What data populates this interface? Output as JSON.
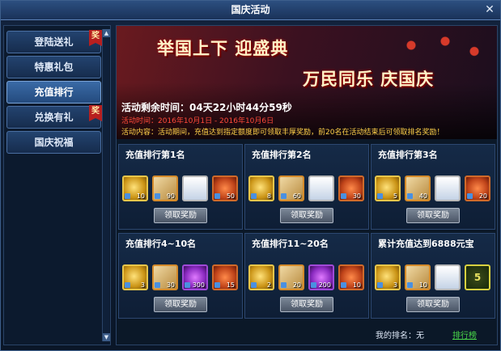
{
  "window": {
    "title": "国庆活动"
  },
  "sidebar": {
    "items": [
      {
        "label": "登陆送礼",
        "badge": "奖",
        "active": false
      },
      {
        "label": "特惠礼包",
        "badge": "",
        "active": false
      },
      {
        "label": "充值排行",
        "badge": "",
        "active": true
      },
      {
        "label": "兑换有礼",
        "badge": "奖",
        "active": false
      },
      {
        "label": "国庆祝福",
        "badge": "",
        "active": false
      }
    ]
  },
  "banner": {
    "line1": "举国上下 迎盛典",
    "line2": "万民同乐 庆国庆",
    "remaining": "活动剩余时间：04天22小时44分59秒",
    "time": "活动时间：2016年10月1日 - 2016年10月6日",
    "desc": "活动内容：活动期间，充值达到指定额度即可领取丰厚奖励，前20名在活动结束后可领取排名奖励！"
  },
  "rewards": [
    {
      "title": "充值排行第1名",
      "button": "领取奖励",
      "items": [
        {
          "kind": "gold",
          "icon": "gold-ingot-icon",
          "qty": "10"
        },
        {
          "kind": "scroll",
          "icon": "scroll-icon",
          "qty": "90"
        },
        {
          "kind": "char",
          "icon": "character-icon",
          "qty": ""
        },
        {
          "kind": "ore",
          "icon": "ore-icon",
          "qty": "50"
        }
      ]
    },
    {
      "title": "充值排行第2名",
      "button": "领取奖励",
      "items": [
        {
          "kind": "gold",
          "icon": "gold-ingot-icon",
          "qty": "8"
        },
        {
          "kind": "scroll",
          "icon": "scroll-icon",
          "qty": "60"
        },
        {
          "kind": "char",
          "icon": "character-icon",
          "qty": ""
        },
        {
          "kind": "ore",
          "icon": "ore-icon",
          "qty": "30"
        }
      ]
    },
    {
      "title": "充值排行第3名",
      "button": "领取奖励",
      "items": [
        {
          "kind": "gold",
          "icon": "gold-ingot-icon",
          "qty": "5"
        },
        {
          "kind": "scroll",
          "icon": "scroll-icon",
          "qty": "40"
        },
        {
          "kind": "char",
          "icon": "character-icon",
          "qty": ""
        },
        {
          "kind": "ore",
          "icon": "ore-icon",
          "qty": "20"
        }
      ]
    },
    {
      "title": "充值排行4~10名",
      "button": "领取奖励",
      "items": [
        {
          "kind": "gold",
          "icon": "gold-ingot-icon",
          "qty": "3"
        },
        {
          "kind": "scroll",
          "icon": "scroll-icon",
          "qty": "30"
        },
        {
          "kind": "gem",
          "icon": "gem-icon",
          "qty": "300"
        },
        {
          "kind": "ore",
          "icon": "ore-icon",
          "qty": "15"
        }
      ]
    },
    {
      "title": "充值排行11~20名",
      "button": "领取奖励",
      "items": [
        {
          "kind": "gold",
          "icon": "gold-ingot-icon",
          "qty": "2"
        },
        {
          "kind": "scroll",
          "icon": "scroll-icon",
          "qty": "20"
        },
        {
          "kind": "gem",
          "icon": "gem-icon",
          "qty": "200"
        },
        {
          "kind": "ore",
          "icon": "ore-icon",
          "qty": "10"
        }
      ]
    },
    {
      "title": "累计充值达到6888元宝",
      "button": "领取奖励",
      "items": [
        {
          "kind": "gold",
          "icon": "gold-ingot-icon",
          "qty": "3"
        },
        {
          "kind": "scroll",
          "icon": "scroll-icon",
          "qty": "10"
        },
        {
          "kind": "char",
          "icon": "character-icon",
          "qty": ""
        },
        {
          "kind": "coin",
          "icon": "coin-icon",
          "qty": "5"
        }
      ]
    }
  ],
  "footer": {
    "my_rank": "我的排名：无",
    "leaderboard": "排行榜"
  },
  "colors": {
    "accent": "#4ad84a",
    "warning": "#ff4a3a",
    "highlight": "#ffd24a"
  }
}
